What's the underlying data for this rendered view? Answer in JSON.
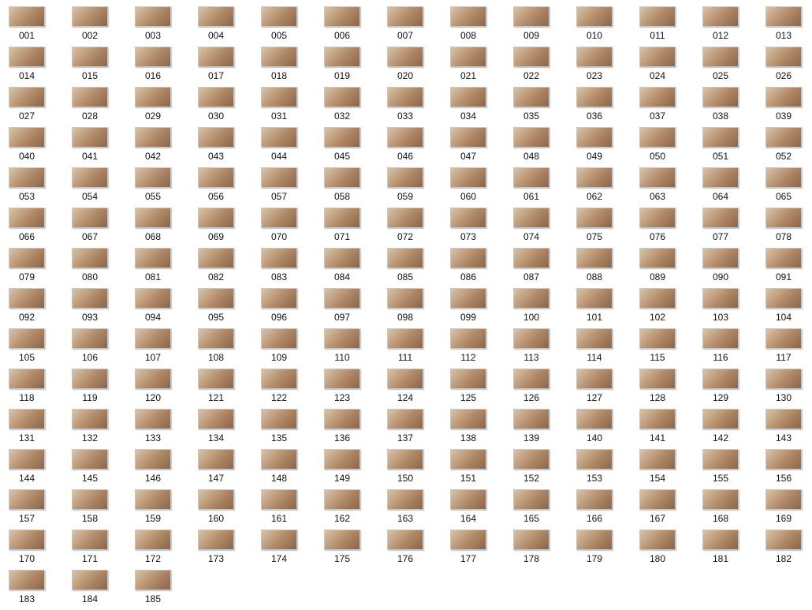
{
  "files": [
    "001",
    "002",
    "003",
    "004",
    "005",
    "006",
    "007",
    "008",
    "009",
    "010",
    "011",
    "012",
    "013",
    "014",
    "015",
    "016",
    "017",
    "018",
    "019",
    "020",
    "021",
    "022",
    "023",
    "024",
    "025",
    "026",
    "027",
    "028",
    "029",
    "030",
    "031",
    "032",
    "033",
    "034",
    "035",
    "036",
    "037",
    "038",
    "039",
    "040",
    "041",
    "042",
    "043",
    "044",
    "045",
    "046",
    "047",
    "048",
    "049",
    "050",
    "051",
    "052",
    "053",
    "054",
    "055",
    "056",
    "057",
    "058",
    "059",
    "060",
    "061",
    "062",
    "063",
    "064",
    "065",
    "066",
    "067",
    "068",
    "069",
    "070",
    "071",
    "072",
    "073",
    "074",
    "075",
    "076",
    "077",
    "078",
    "079",
    "080",
    "081",
    "082",
    "083",
    "084",
    "085",
    "086",
    "087",
    "088",
    "089",
    "090",
    "091",
    "092",
    "093",
    "094",
    "095",
    "096",
    "097",
    "098",
    "099",
    "100",
    "101",
    "102",
    "103",
    "104",
    "105",
    "106",
    "107",
    "108",
    "109",
    "110",
    "111",
    "112",
    "113",
    "114",
    "115",
    "116",
    "117",
    "118",
    "119",
    "120",
    "121",
    "122",
    "123",
    "124",
    "125",
    "126",
    "127",
    "128",
    "129",
    "130",
    "131",
    "132",
    "133",
    "134",
    "135",
    "136",
    "137",
    "138",
    "139",
    "140",
    "141",
    "142",
    "143",
    "144",
    "145",
    "146",
    "147",
    "148",
    "149",
    "150",
    "151",
    "152",
    "153",
    "154",
    "155",
    "156",
    "157",
    "158",
    "159",
    "160",
    "161",
    "162",
    "163",
    "164",
    "165",
    "166",
    "167",
    "168",
    "169",
    "170",
    "171",
    "172",
    "173",
    "174",
    "175",
    "176",
    "177",
    "178",
    "179",
    "180",
    "181",
    "182",
    "183",
    "184",
    "185"
  ]
}
